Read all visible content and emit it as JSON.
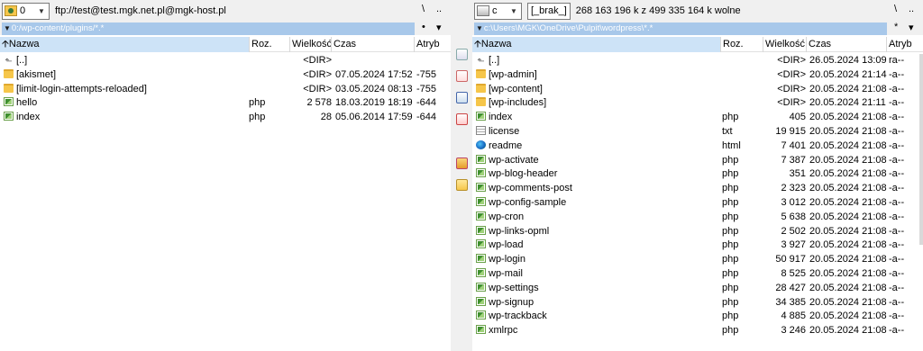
{
  "left": {
    "drive": "0",
    "path_label": "ftp://test@test.mgk.net.pl@mgk-host.pl",
    "toolbar_root": "\\",
    "toolbar_up": "..",
    "toolbar_star": "•",
    "toolbar_arrow": "▾",
    "current_path": "0:/wp-content/plugins/*.*",
    "columns": [
      "Nazwa",
      "Roz.",
      "Wielkość",
      "Czas",
      "Atryb"
    ],
    "files": [
      {
        "icon": "up",
        "name": "[..]",
        "ext": "",
        "size": "<DIR>",
        "time": "",
        "attr": ""
      },
      {
        "icon": "folder",
        "name": "[akismet]",
        "ext": "",
        "size": "<DIR>",
        "time": "07.05.2024 17:52",
        "attr": "-755"
      },
      {
        "icon": "folder",
        "name": "[limit-login-attempts-reloaded]",
        "ext": "",
        "size": "<DIR>",
        "time": "03.05.2024 08:13",
        "attr": "-755"
      },
      {
        "icon": "php",
        "name": "hello",
        "ext": "php",
        "size": "2 578",
        "time": "18.03.2019 18:19",
        "attr": "-644"
      },
      {
        "icon": "php",
        "name": "index",
        "ext": "php",
        "size": "28",
        "time": "05.06.2014 17:59",
        "attr": "-644"
      }
    ]
  },
  "right": {
    "drive": "c",
    "label_bracket": "[_brak_]",
    "free_space": "268 163 196 k z 499 335 164 k wolne",
    "toolbar_root": "\\",
    "toolbar_up": "..",
    "toolbar_star": "*",
    "toolbar_arrow": "▾",
    "current_path": "c:\\Users\\MGK\\OneDrive\\Pulpit\\wordpress\\*.*",
    "columns": [
      "Nazwa",
      "Roz.",
      "Wielkość",
      "Czas",
      "Atryb"
    ],
    "files": [
      {
        "icon": "up",
        "name": "[..]",
        "ext": "",
        "size": "<DIR>",
        "time": "26.05.2024 13:09",
        "attr": "ra--"
      },
      {
        "icon": "folder",
        "name": "[wp-admin]",
        "ext": "",
        "size": "<DIR>",
        "time": "20.05.2024 21:14",
        "attr": "-a--"
      },
      {
        "icon": "folder",
        "name": "[wp-content]",
        "ext": "",
        "size": "<DIR>",
        "time": "20.05.2024 21:08",
        "attr": "-a--"
      },
      {
        "icon": "folder",
        "name": "[wp-includes]",
        "ext": "",
        "size": "<DIR>",
        "time": "20.05.2024 21:11",
        "attr": "-a--"
      },
      {
        "icon": "php",
        "name": "index",
        "ext": "php",
        "size": "405",
        "time": "20.05.2024 21:08",
        "attr": "-a--"
      },
      {
        "icon": "txt",
        "name": "license",
        "ext": "txt",
        "size": "19 915",
        "time": "20.05.2024 21:08",
        "attr": "-a--"
      },
      {
        "icon": "edge",
        "name": "readme",
        "ext": "html",
        "size": "7 401",
        "time": "20.05.2024 21:08",
        "attr": "-a--"
      },
      {
        "icon": "php",
        "name": "wp-activate",
        "ext": "php",
        "size": "7 387",
        "time": "20.05.2024 21:08",
        "attr": "-a--"
      },
      {
        "icon": "php",
        "name": "wp-blog-header",
        "ext": "php",
        "size": "351",
        "time": "20.05.2024 21:08",
        "attr": "-a--"
      },
      {
        "icon": "php",
        "name": "wp-comments-post",
        "ext": "php",
        "size": "2 323",
        "time": "20.05.2024 21:08",
        "attr": "-a--"
      },
      {
        "icon": "php",
        "name": "wp-config-sample",
        "ext": "php",
        "size": "3 012",
        "time": "20.05.2024 21:08",
        "attr": "-a--"
      },
      {
        "icon": "php",
        "name": "wp-cron",
        "ext": "php",
        "size": "5 638",
        "time": "20.05.2024 21:08",
        "attr": "-a--"
      },
      {
        "icon": "php",
        "name": "wp-links-opml",
        "ext": "php",
        "size": "2 502",
        "time": "20.05.2024 21:08",
        "attr": "-a--"
      },
      {
        "icon": "php",
        "name": "wp-load",
        "ext": "php",
        "size": "3 927",
        "time": "20.05.2024 21:08",
        "attr": "-a--"
      },
      {
        "icon": "php",
        "name": "wp-login",
        "ext": "php",
        "size": "50 917",
        "time": "20.05.2024 21:08",
        "attr": "-a--"
      },
      {
        "icon": "php",
        "name": "wp-mail",
        "ext": "php",
        "size": "8 525",
        "time": "20.05.2024 21:08",
        "attr": "-a--"
      },
      {
        "icon": "php",
        "name": "wp-settings",
        "ext": "php",
        "size": "28 427",
        "time": "20.05.2024 21:08",
        "attr": "-a--"
      },
      {
        "icon": "php",
        "name": "wp-signup",
        "ext": "php",
        "size": "34 385",
        "time": "20.05.2024 21:08",
        "attr": "-a--"
      },
      {
        "icon": "php",
        "name": "wp-trackback",
        "ext": "php",
        "size": "4 885",
        "time": "20.05.2024 21:08",
        "attr": "-a--"
      },
      {
        "icon": "php",
        "name": "xmlrpc",
        "ext": "php",
        "size": "3 246",
        "time": "20.05.2024 21:08",
        "attr": "-a--"
      }
    ]
  },
  "middle_buttons": [
    "file-search-icon",
    "file-properties-icon",
    "copy-files-icon",
    "move-files-icon",
    "archive-icon",
    "new-folder-icon"
  ],
  "colors": {
    "path_highlight": "#a8c8ea",
    "header_active": "#cde3f7",
    "folder": "#f6c64a",
    "php_icon": "#3f8f2f"
  }
}
